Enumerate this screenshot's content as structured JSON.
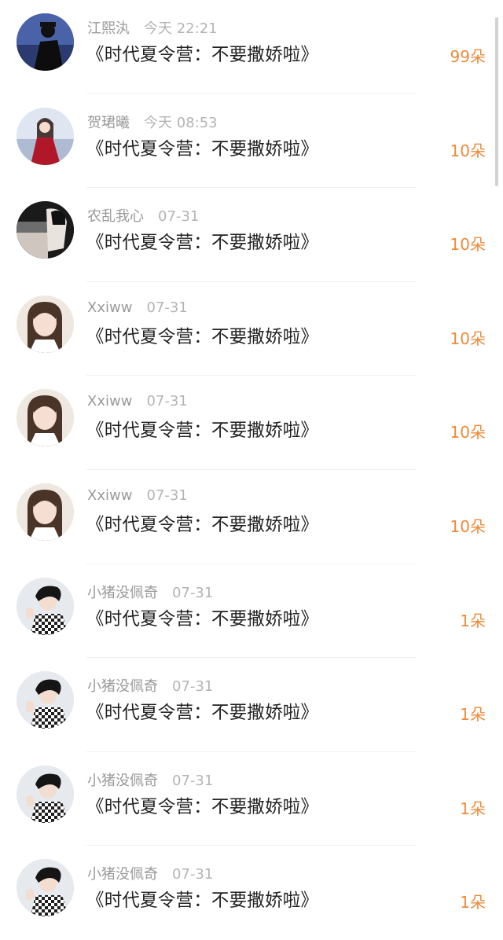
{
  "items": [
    {
      "name": "江熙汍",
      "time": "今天 22:21",
      "title": "《时代夏令营：不要撒娇啦》",
      "count": "99朵",
      "avatar": "sea-silhouette"
    },
    {
      "name": "贺珺曦",
      "time": "今天 08:53",
      "title": "《时代夏令营：不要撒娇啦》",
      "count": "10朵",
      "avatar": "red-dress-girl"
    },
    {
      "name": "农乱我心",
      "time": "07-31",
      "title": "《时代夏令营：不要撒娇啦》",
      "count": "10朵",
      "avatar": "girl-dark"
    },
    {
      "name": "Xxiww",
      "time": "07-31",
      "title": "《时代夏令营：不要撒娇啦》",
      "count": "10朵",
      "avatar": "girl-smile"
    },
    {
      "name": "Xxiww",
      "time": "07-31",
      "title": "《时代夏令营：不要撒娇啦》",
      "count": "10朵",
      "avatar": "girl-smile"
    },
    {
      "name": "Xxiww",
      "time": "07-31",
      "title": "《时代夏令营：不要撒娇啦》",
      "count": "10朵",
      "avatar": "girl-smile"
    },
    {
      "name": "小猪没佩奇",
      "time": "07-31",
      "title": "《时代夏令营：不要撒娇啦》",
      "count": "1朵",
      "avatar": "boy-checkered"
    },
    {
      "name": "小猪没佩奇",
      "time": "07-31",
      "title": "《时代夏令营：不要撒娇啦》",
      "count": "1朵",
      "avatar": "boy-checkered"
    },
    {
      "name": "小猪没佩奇",
      "time": "07-31",
      "title": "《时代夏令营：不要撒娇啦》",
      "count": "1朵",
      "avatar": "boy-checkered"
    },
    {
      "name": "小猪没佩奇",
      "time": "07-31",
      "title": "《时代夏令营：不要撒娇啦》",
      "count": "1朵",
      "avatar": "boy-checkered"
    }
  ],
  "colors": {
    "count": "#ee8a3a",
    "name": "#9a9a9a",
    "title": "#222222"
  }
}
